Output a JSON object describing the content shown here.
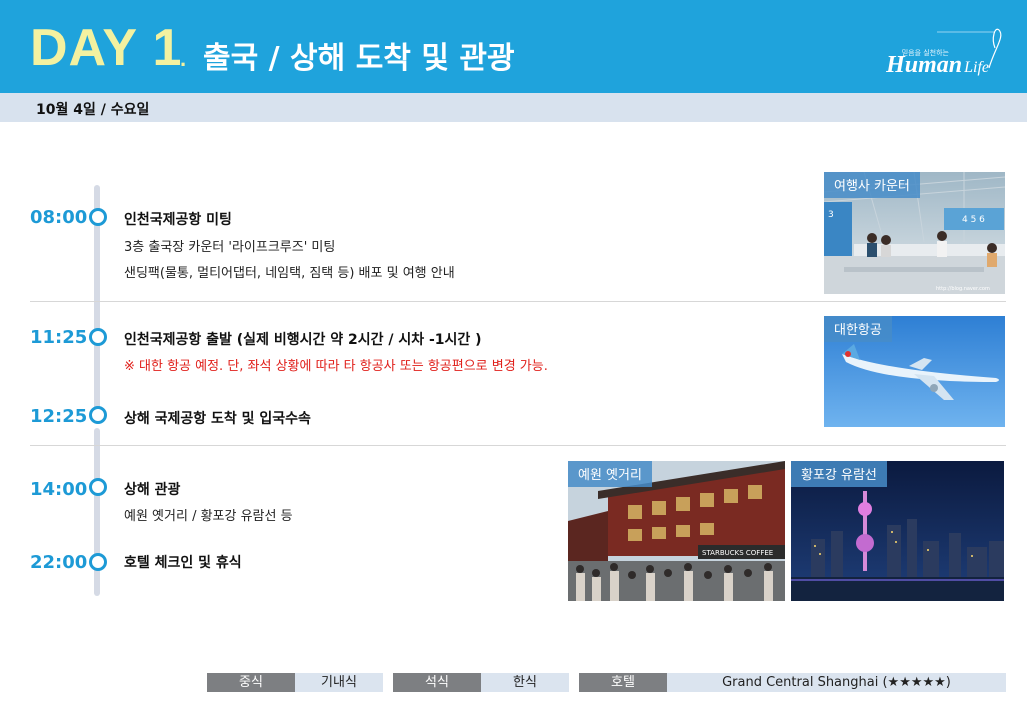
{
  "header": {
    "day": "DAY 1",
    "dot": ".",
    "title": "출국 / 상해 도착 및 관광",
    "logo_text": "Human",
    "logo_script": "Life",
    "logo_tagline": "믿음을 실천하는"
  },
  "date": "10월 4일 / 수요일",
  "schedule": [
    {
      "time": "08:00",
      "lines": [
        "인천국제공항 미팅",
        "3층 출국장 카운터 '라이프크루즈' 미팅",
        "샌딩팩(물통, 멀티어댑터, 네임택, 짐택 등) 배포 및 여행 안내"
      ]
    },
    {
      "time": "11:25",
      "lines": [
        "인천국제공항 출발 (실제 비행시간 약 2시간 / 시차 -1시간 )",
        "※ 대한 항공 예정. 단, 좌석 상황에 따라 타 항공사 또는 항공편으로 변경 가능."
      ]
    },
    {
      "time": "12:25",
      "lines": [
        "상해 국제공항 도착 및 입국수속"
      ]
    },
    {
      "time": "14:00",
      "lines": [
        "상해 관광",
        "예원 옛거리 / 황포강 유람선 등"
      ]
    },
    {
      "time": "22:00",
      "lines": [
        "호텔 체크인 및 휴식"
      ]
    }
  ],
  "photos": {
    "counter": "여행사 카운터",
    "airline": "대한항공",
    "yuyuan": "예원 옛거리",
    "huangpu": "황포강 유람선",
    "counter_watermark": "http://blog.naver.com",
    "starbucks_sign": "STARBUCKS COFFEE"
  },
  "meals": {
    "breakfast_label": "중식",
    "breakfast_value": "기내식",
    "dinner_label": "석식",
    "dinner_value": "한식",
    "hotel_label": "호텔",
    "hotel_value": "Grand Central Shanghai (★★★★★)"
  },
  "colors": {
    "header_bg": "#1fa3dc",
    "day_text": "#f3f1a0",
    "accent": "#1d9ad6",
    "warning": "#e0201b",
    "datebar_bg": "#d8e2ee",
    "meal_label_bg": "#7d7f82",
    "meal_value_bg": "#dbe4ef"
  },
  "icons": {
    "timeline_marker": "circle-outline-icon",
    "logo": "human-life-logo"
  }
}
